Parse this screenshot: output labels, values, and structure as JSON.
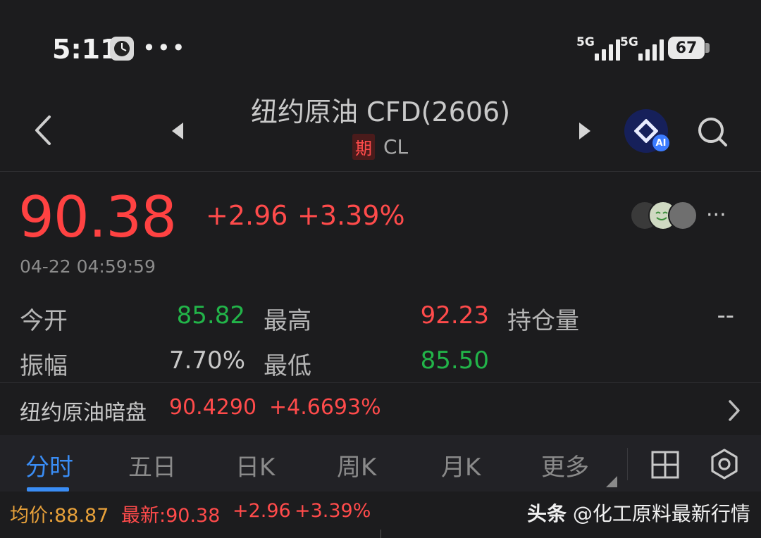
{
  "status_bar": {
    "time": "5:11",
    "more": "•••",
    "net1": "5G",
    "net2": "5G",
    "battery": "67"
  },
  "header": {
    "title": "纽约原油 CFD(2606)",
    "tag": "期",
    "code": "CL",
    "ai_badge": "AI"
  },
  "quote": {
    "price": "90.38",
    "change": "+2.96",
    "change_pct": "+3.39%",
    "timestamp": "04-22 04:59:59",
    "more": "···"
  },
  "stats": [
    {
      "label": "今开",
      "value": "85.82",
      "color": "green"
    },
    {
      "label": "最高",
      "value": "92.23",
      "color": "red"
    },
    {
      "label": "持仓量",
      "value": "--",
      "color": "gray"
    },
    {
      "label": "振幅",
      "value": "7.70%",
      "color": "gray"
    },
    {
      "label": "最低",
      "value": "85.50",
      "color": "green"
    }
  ],
  "dark_pool": {
    "label": "纽约原油暗盘",
    "value": "90.4290",
    "change_pct": "+4.6693%"
  },
  "tabs": {
    "items": [
      "分时",
      "五日",
      "日K",
      "周K",
      "月K",
      "更多"
    ],
    "active": "分时"
  },
  "bottom_info": {
    "avg": "均价:88.87",
    "latest": "最新:90.38",
    "change": "+2.96",
    "change_pct": "+3.39%"
  },
  "watermark": {
    "prefix": "头条",
    "text": " @化工原料最新行情"
  },
  "colors": {
    "up": "#ff4b4b",
    "down": "#22b449",
    "accent": "#3a8df5",
    "background": "#1c1c1e"
  }
}
